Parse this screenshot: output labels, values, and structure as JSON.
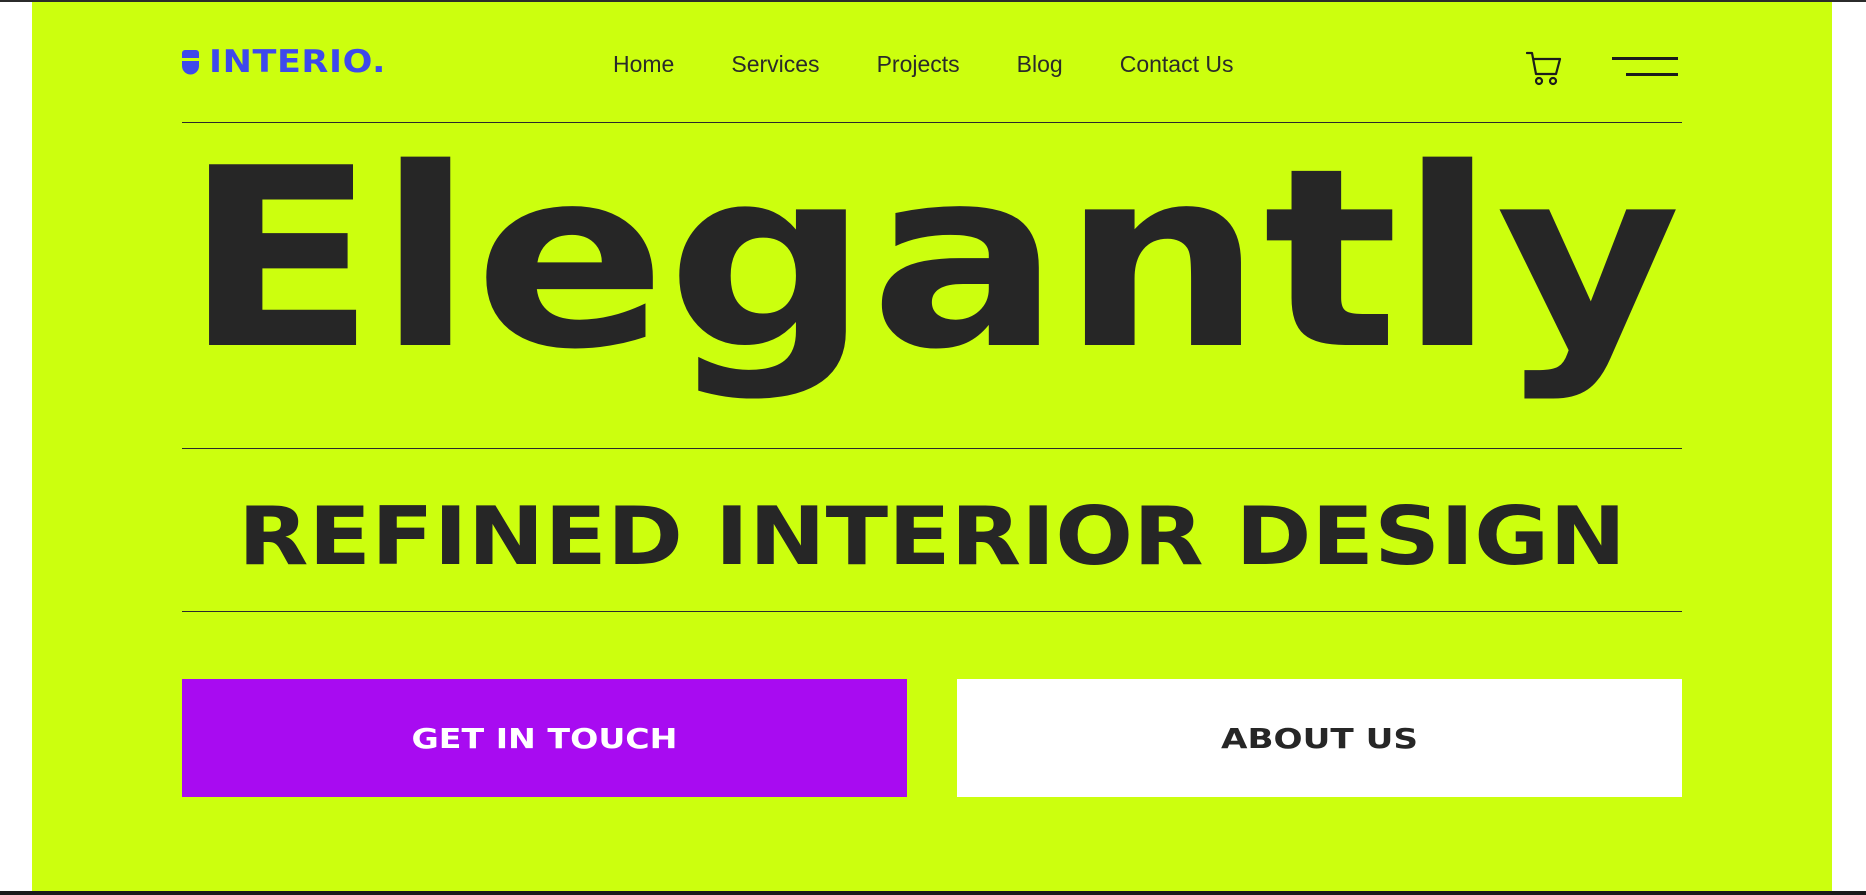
{
  "brand": {
    "name": "INTERIO.",
    "color": "#3e49ec",
    "icon": "logo-mark-icon"
  },
  "nav": {
    "items": [
      {
        "label": "Home"
      },
      {
        "label": "Services"
      },
      {
        "label": "Projects"
      },
      {
        "label": "Blog"
      },
      {
        "label": "Contact Us"
      }
    ]
  },
  "header": {
    "cart_icon": "cart-icon",
    "menu_icon": "hamburger-menu-icon"
  },
  "hero": {
    "headline": "Elegantly",
    "subheadline": "REFINED INTERIOR DESIGN",
    "background_color": "#ccff0e",
    "text_color": "#262626"
  },
  "buttons": {
    "primary": {
      "label": "GET IN TOUCH",
      "background": "#a80bf1",
      "text_color": "#ffffff"
    },
    "secondary": {
      "label": "ABOUT US",
      "background": "#ffffff",
      "text_color": "#262626"
    }
  }
}
